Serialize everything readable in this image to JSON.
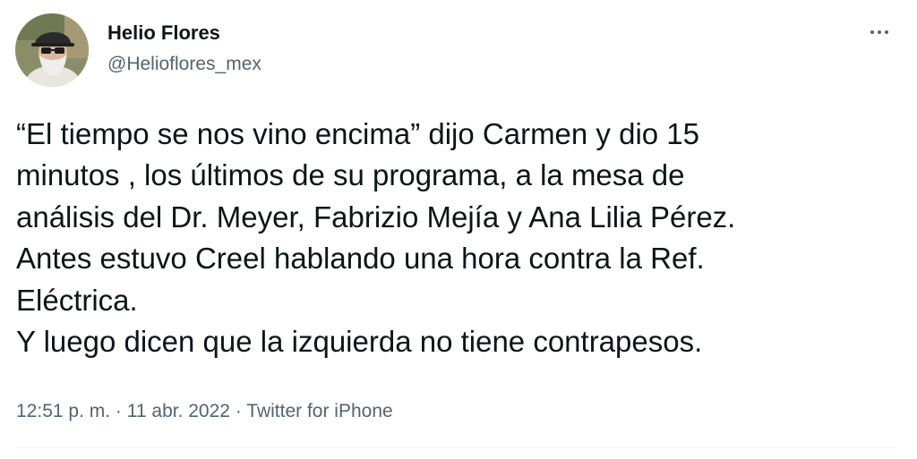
{
  "author": {
    "name": "Helio Flores",
    "handle": "@Helioflores_mex",
    "avatar_icon": "profile-photo-icon"
  },
  "more_icon": "more-horizontal-icon",
  "tweet": {
    "lines": [
      "“El tiempo se nos vino encima” dijo Carmen y dio 15",
      "minutos , los últimos de su programa, a la mesa de",
      "análisis del Dr. Meyer, Fabrizio Mejía y Ana Lilia Pérez.",
      "Antes estuvo Creel hablando una hora contra la Ref.",
      "Eléctrica.",
      "Y luego dicen que la izquierda no tiene contrapesos."
    ]
  },
  "meta": {
    "time": "12:51 p. m.",
    "separator": "·",
    "date": "11 abr. 2022",
    "source": "Twitter for iPhone"
  },
  "colors": {
    "text_primary": "#0f1419",
    "text_secondary": "#536471",
    "divider": "#eff3f4"
  }
}
